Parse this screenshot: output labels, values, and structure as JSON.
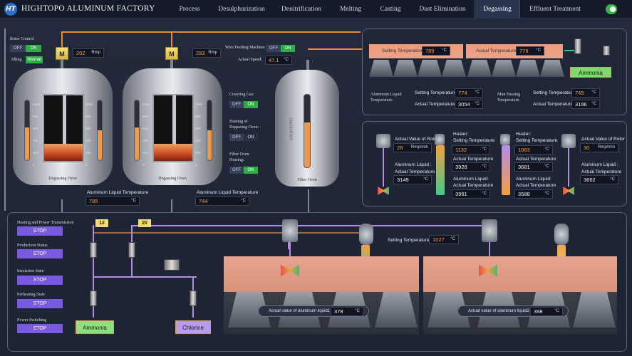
{
  "header": {
    "logo": "HT",
    "title": "HIGHTOPO ALUMINUM FACTORY",
    "tabs": [
      "Process",
      "Desulphurization",
      "Denitrification",
      "Melting",
      "Casting",
      "Dust Elimination",
      "Degassing",
      "Effluent Treatment"
    ],
    "active_tab": "Degassing"
  },
  "rotor_control": {
    "title": "Rotor Control",
    "off": "OFF",
    "on": "ON",
    "idling": "Idling",
    "normal": "Normal"
  },
  "degassing_oven_1": {
    "motor": "M",
    "speed": "202",
    "speed_unit": "Rmp",
    "name": "Degassing Oven",
    "temp_label": "Aluminum Liquid Temperature",
    "temp": "785",
    "temp_unit": "°C",
    "scale": [
      "1000",
      "800",
      "600",
      "400",
      "200",
      "0"
    ],
    "level_left": 0.55,
    "level_right": 0.5
  },
  "degassing_oven_2": {
    "motor": "M",
    "speed": "293",
    "speed_unit": "Rmp",
    "name": "Degassing Oven",
    "temp_label": "Aluminum Liquid Temperature",
    "temp": "744",
    "temp_unit": "°C",
    "scale": [
      "1000",
      "800",
      "600",
      "400",
      "200",
      "0"
    ],
    "level_left": 0.55,
    "level_right": 0.5
  },
  "wire_feeding": {
    "label": "Wire Feeding Machine:",
    "off": "OFF",
    "on": "ON",
    "speed_label": "Actual Speed:",
    "speed": "47.1",
    "speed_unit": "°C"
  },
  "covering_gas": {
    "label": "Covering Gas:",
    "off": "OFF",
    "on": "ON"
  },
  "heating_degassing": {
    "label1": "Heating of",
    "label2": "Degassing Oven:",
    "off": "OFF",
    "on": "ON"
  },
  "filter_heating": {
    "label1": "Filter Oven",
    "label2": "Heating:",
    "off": "OFF",
    "on": "ON"
  },
  "filter_oven": {
    "name": "Filter Oven",
    "brand": "HIGHTOPO",
    "level": 0.62
  },
  "top_right": {
    "setting_temp_label": "Setting Temperature",
    "setting_temp": "789",
    "unit": "°C",
    "actual_temp_label": "Actual Temperature",
    "actual_temp": "776",
    "gas": "Ammonia",
    "al_label1": "Aluminum Liquid",
    "al_label2": "Temperature:",
    "al_setting_label": "Setting Temperature",
    "al_setting": "774",
    "al_actual_label": "Actual Temperature",
    "al_actual": "3054",
    "mini_label1": "Mini Heating",
    "mini_label2": "Temperature:",
    "mini_setting_label": "Setting Temperature",
    "mini_setting": "745",
    "mini_actual_label": "Actual Temperature",
    "mini_actual": "3196"
  },
  "mid_right": {
    "rotor1_label": "Actual Value of Rotor",
    "rotor1": "28",
    "rotor1_unit": "Rmp/min",
    "heater1_title": "Heater:",
    "heater1_setting_label": "Setting Temperature",
    "heater1_setting": "1132",
    "heater1_actual_label": "Actual Temperature",
    "heater1_actual": "3928",
    "al1_title": "Aluminum Liquid :",
    "al1_label": "Actual Temperature",
    "al1": "3149",
    "al2_title": "Aluminum Liquid:",
    "al2_label": "Actual Temperature",
    "al2": "3951",
    "heater2_title": "Heater:",
    "heater2_setting_label": "Setting Temperature",
    "heater2_setting": "1063",
    "heater2_actual_label": "Actual Temperature",
    "heater2_actual": "3681",
    "al3_title": "Aluminum Liquid:",
    "al3_label": "Actual Temperature",
    "al3": "3588",
    "rotor2_label": "Actual Value of Rotor",
    "rotor2": "30",
    "rotor2_unit": "Rmp/min",
    "al4_title": "Aluminum Liquid :",
    "al4_label": "Actual Temperature",
    "al4": "3662",
    "unit": "°C"
  },
  "bottom": {
    "controls": [
      {
        "label": "Heating and Power Transmission",
        "button": "STOP"
      },
      {
        "label": "Production Status",
        "button": "STOP"
      },
      {
        "label": "Insulation State",
        "button": "STOP"
      },
      {
        "label": "Preheating State",
        "button": "STOP"
      },
      {
        "label": "Power Switching",
        "button": "STOP"
      }
    ],
    "tag1": "1#",
    "tag2": "2#",
    "gas1": "Ammonia",
    "gas2": "Chlorine",
    "setting_label": "Setting Temperature :",
    "setting": "1027",
    "unit": "°C",
    "liquid1_label": "Actual value of aluminum liquid1",
    "liquid1": "378",
    "liquid2_label": "Actual value of aluminum liquid2",
    "liquid2": "398"
  }
}
